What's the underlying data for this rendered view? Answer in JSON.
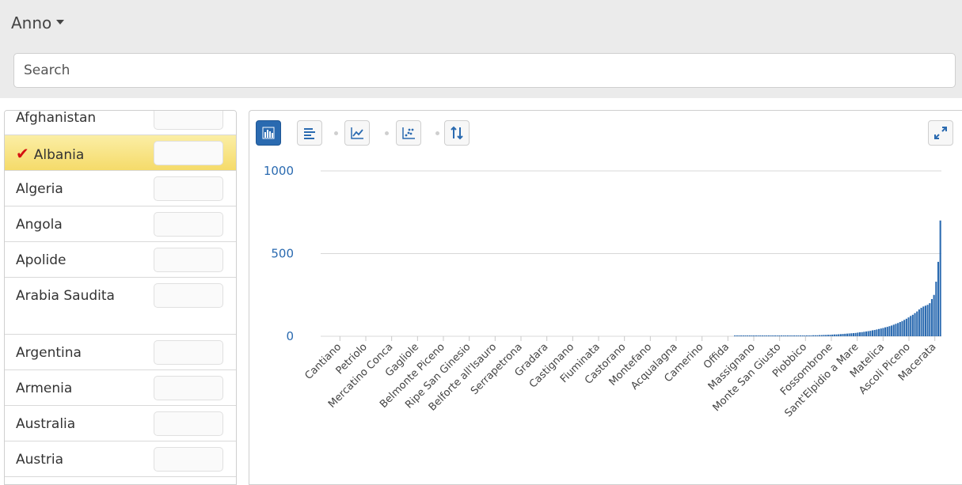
{
  "filter": {
    "title": "Anno",
    "search_placeholder": "Search"
  },
  "countries": [
    {
      "name": "Afghanistan",
      "selected": false
    },
    {
      "name": "Albania",
      "selected": true
    },
    {
      "name": "Algeria",
      "selected": false
    },
    {
      "name": "Angola",
      "selected": false
    },
    {
      "name": "Apolide",
      "selected": false
    },
    {
      "name": "Arabia Saudita",
      "selected": false
    },
    {
      "name": "Argentina",
      "selected": false
    },
    {
      "name": "Armenia",
      "selected": false
    },
    {
      "name": "Australia",
      "selected": false
    },
    {
      "name": "Austria",
      "selected": false
    }
  ],
  "toolbar": {
    "buttons": [
      {
        "name": "column-chart-button",
        "icon": "column-chart-icon",
        "active": true
      },
      {
        "name": "bar-chart-button",
        "icon": "bar-chart-icon",
        "active": false
      },
      {
        "name": "line-chart-button",
        "icon": "line-chart-icon",
        "active": false
      },
      {
        "name": "scatter-chart-button",
        "icon": "scatter-chart-icon",
        "active": false
      },
      {
        "name": "sort-button",
        "icon": "sort-icon",
        "active": false
      }
    ],
    "expand_icon": "expand-icon"
  },
  "chart_data": {
    "type": "bar",
    "color": "#2a6ab0",
    "ylim": [
      0,
      1000
    ],
    "yticks": [
      0,
      500,
      1000
    ],
    "grid": true,
    "sort": "ascending",
    "tick_labels": [
      "Cantiano",
      "Petriolo",
      "Mercatino Conca",
      "Gagliole",
      "Belmonte Piceno",
      "Ripe San Ginesio",
      "Belforte all'Isauro",
      "Serrapetrona",
      "Gradara",
      "Castignano",
      "Fiuminata",
      "Castorano",
      "Montefano",
      "Acqualagna",
      "Camerino",
      "Offida",
      "Massignano",
      "Monte San Giusto",
      "Piobbico",
      "Fossombrone",
      "Sant'Elpidio a Mare",
      "Matelica",
      "Ascoli Piceno",
      "Macerata"
    ],
    "values": [
      0,
      0,
      0,
      0,
      0,
      0,
      0,
      0,
      0,
      0,
      0,
      0,
      0,
      0,
      0,
      0,
      0,
      0,
      0,
      0,
      0,
      0,
      0,
      0,
      0,
      0,
      0,
      0,
      0,
      0,
      0,
      0,
      0,
      0,
      0,
      0,
      0,
      0,
      0,
      0,
      0,
      0,
      0,
      0,
      0,
      0,
      0,
      0,
      0,
      0,
      0,
      0,
      0,
      0,
      0,
      0,
      0,
      0,
      0,
      0,
      0,
      0,
      0,
      0,
      0,
      0,
      0,
      0,
      0,
      0,
      0,
      0,
      0,
      0,
      0,
      0,
      0,
      0,
      0,
      0,
      0,
      0,
      0,
      0,
      0,
      0,
      0,
      0,
      0,
      0,
      0,
      0,
      0,
      0,
      0,
      0,
      0,
      0,
      0,
      0,
      0,
      0,
      0,
      0,
      0,
      0,
      0,
      0,
      0,
      0,
      0,
      0,
      0,
      0,
      0,
      0,
      0,
      0,
      0,
      0,
      0,
      0,
      0,
      0,
      0,
      0,
      0,
      0,
      0,
      0,
      0,
      0,
      0,
      0,
      0,
      0,
      0,
      0,
      0,
      0,
      0,
      0,
      0,
      0,
      0,
      0,
      0,
      0,
      0,
      0,
      0,
      0,
      0,
      0,
      0,
      0,
      0,
      0,
      0,
      0,
      0,
      0,
      0,
      0,
      0,
      0,
      0,
      0,
      0,
      0,
      0,
      0,
      0,
      0,
      0,
      0,
      0,
      0,
      0,
      0,
      0,
      0,
      0,
      0,
      0,
      0,
      0,
      0,
      0,
      0,
      0,
      0,
      0,
      0,
      0,
      1,
      1,
      1,
      1,
      1,
      1,
      1,
      1,
      1,
      1,
      1,
      1,
      1,
      2,
      2,
      2,
      2,
      2,
      2,
      2,
      2,
      2,
      3,
      3,
      3,
      3,
      3,
      3,
      3,
      4,
      4,
      4,
      4,
      4,
      5,
      5,
      5,
      6,
      6,
      6,
      7,
      7,
      8,
      8,
      9,
      9,
      10,
      11,
      11,
      12,
      13,
      14,
      15,
      16,
      17,
      18,
      19,
      20,
      22,
      24,
      25,
      27,
      29,
      31,
      33,
      36,
      38,
      41,
      44,
      47,
      50,
      54,
      57,
      61,
      65,
      70,
      75,
      80,
      86,
      92,
      99,
      106,
      114,
      123,
      130,
      140,
      150,
      162,
      172,
      180,
      185,
      190,
      200,
      225,
      250,
      330,
      450,
      700
    ]
  }
}
